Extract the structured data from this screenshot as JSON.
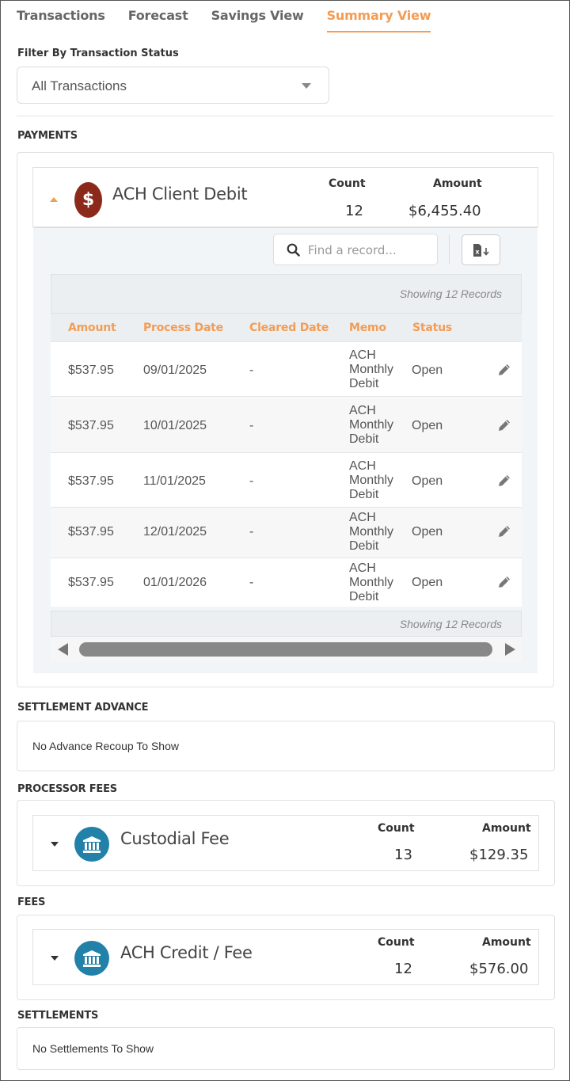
{
  "tabs": [
    {
      "label": "Transactions"
    },
    {
      "label": "Forecast"
    },
    {
      "label": "Savings View"
    },
    {
      "label": "Summary View"
    }
  ],
  "filter": {
    "label": "Filter By Transaction Status",
    "value": "All Transactions"
  },
  "payments": {
    "section_title": "PAYMENTS",
    "card": {
      "title": "ACH Client Debit",
      "icon": "dollar-icon",
      "icon_color": "#8b2a1a",
      "count_label": "Count",
      "count": "12",
      "amount_label": "Amount",
      "amount": "$6,455.40"
    },
    "search_placeholder": "Find a record...",
    "showing": "Showing 12 Records",
    "columns": [
      "Amount",
      "Process Date",
      "Cleared Date",
      "Memo",
      "Status"
    ],
    "rows": [
      {
        "amount": "$537.95",
        "process_date": "09/01/2025",
        "cleared_date": "-",
        "memo": [
          "ACH",
          "Monthly",
          "Debit"
        ],
        "status": "Open"
      },
      {
        "amount": "$537.95",
        "process_date": "10/01/2025",
        "cleared_date": "-",
        "memo": [
          "ACH",
          "Monthly",
          "Debit"
        ],
        "status": "Open"
      },
      {
        "amount": "$537.95",
        "process_date": "11/01/2025",
        "cleared_date": "-",
        "memo": [
          "ACH",
          "Monthly",
          "Debit"
        ],
        "status": "Open"
      },
      {
        "amount": "$537.95",
        "process_date": "12/01/2025",
        "cleared_date": "-",
        "memo": [
          "ACH",
          "Monthly",
          "Debit"
        ],
        "status": "Open"
      },
      {
        "amount": "$537.95",
        "process_date": "01/01/2026",
        "cleared_date": "-",
        "memo": [
          "ACH",
          "Monthly",
          "Debit"
        ],
        "status": "Open"
      }
    ]
  },
  "settlement_advance": {
    "section_title": "SETTLEMENT ADVANCE",
    "message": "No Advance Recoup To Show"
  },
  "processor_fees": {
    "section_title": "PROCESSOR FEES",
    "card": {
      "title": "Custodial Fee",
      "icon": "bank-icon",
      "icon_color": "#2281a8",
      "count_label": "Count",
      "count": "13",
      "amount_label": "Amount",
      "amount": "$129.35"
    }
  },
  "fees": {
    "section_title": "FEES",
    "card": {
      "title": "ACH Credit / Fee",
      "icon": "bank-icon",
      "icon_color": "#2281a8",
      "count_label": "Count",
      "count": "12",
      "amount_label": "Amount",
      "amount": "$576.00"
    }
  },
  "settlements": {
    "section_title": "SETTLEMENTS",
    "message": "No Settlements To Show"
  },
  "colors": {
    "accent": "#f39c54",
    "dollar_circle": "#8b2a1a",
    "bank_circle": "#2281a8"
  }
}
